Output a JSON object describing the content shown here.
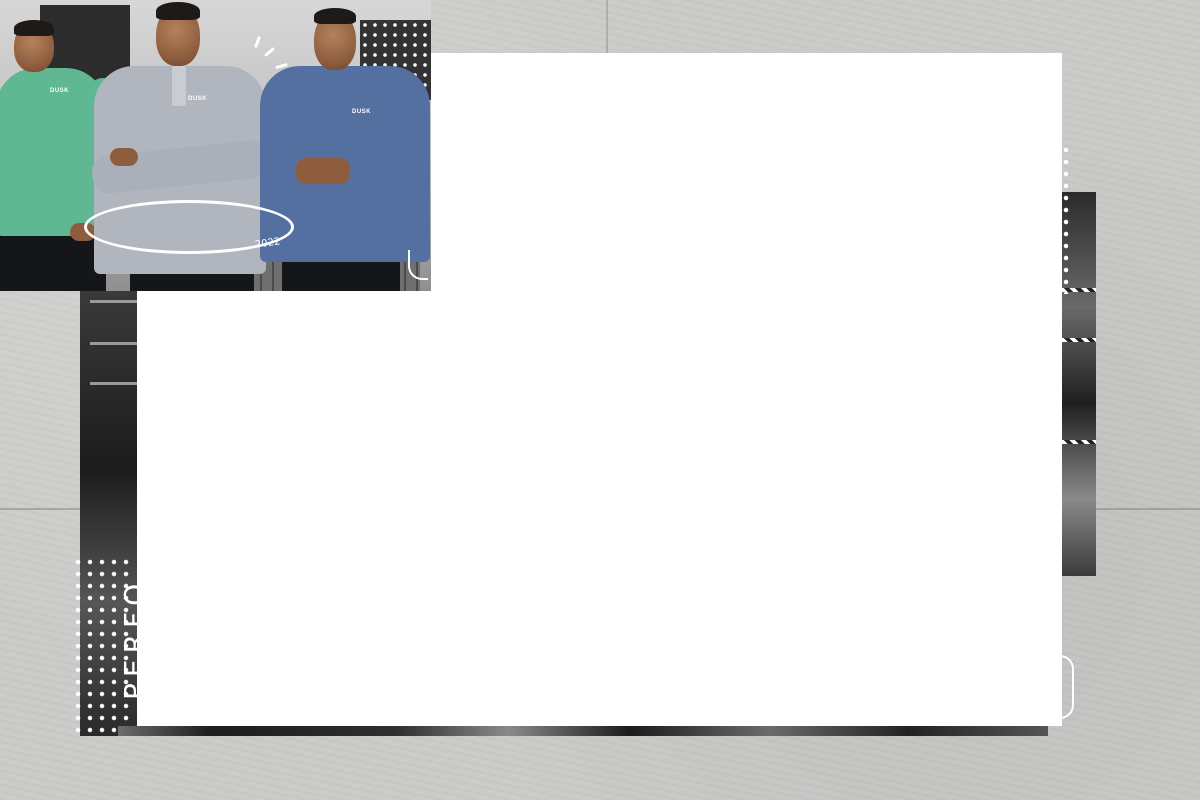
{
  "background": {
    "side_text": "PERFO",
    "accent_color": "#ffffff",
    "panel_color": "#ffffff"
  },
  "hero": {
    "year_text": "2022",
    "models": [
      {
        "shirt_color": "#5fb892",
        "logo_text": "DUSK"
      },
      {
        "shirt_color": "#b1b6be",
        "logo_text": "DUSK"
      },
      {
        "shirt_color": "#5470a1",
        "logo_text": "DUSK"
      }
    ]
  }
}
